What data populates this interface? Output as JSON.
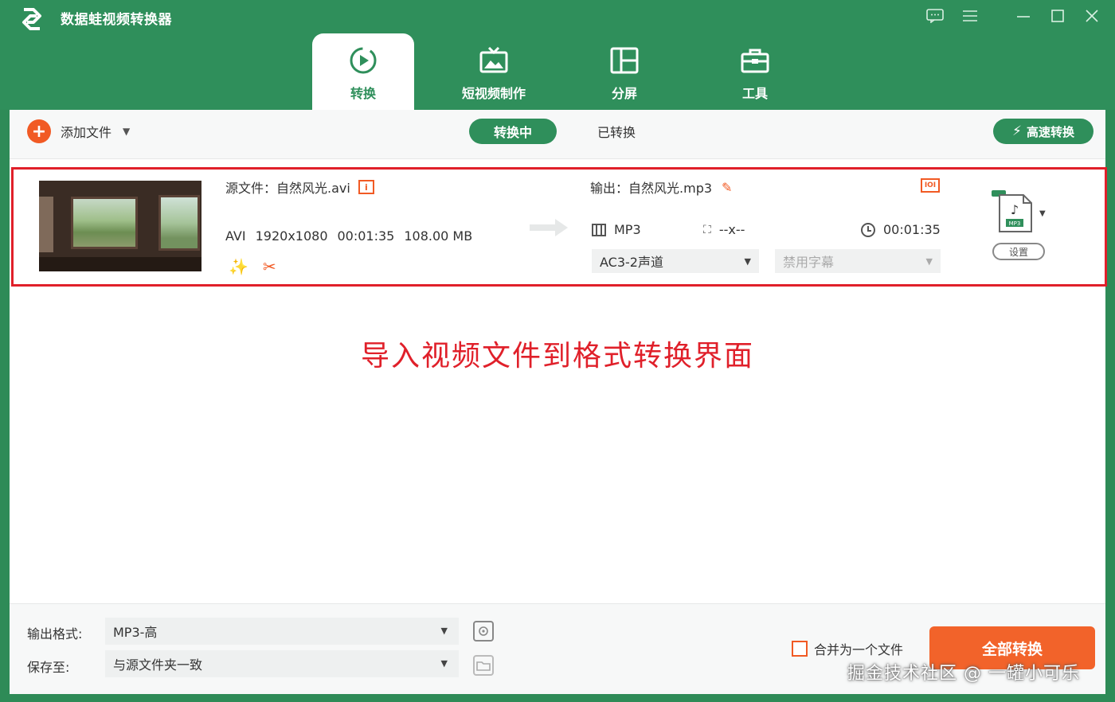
{
  "app": {
    "title": "数据蛙视频转换器"
  },
  "tabs": [
    {
      "label": "转换",
      "active": true
    },
    {
      "label": "短视频制作",
      "active": false
    },
    {
      "label": "分屏",
      "active": false
    },
    {
      "label": "工具",
      "active": false
    }
  ],
  "toolbar": {
    "add_file_label": "添加文件",
    "segment_active": "转换中",
    "segment_inactive": "已转换",
    "turbo_label": "高速转换"
  },
  "file_item": {
    "source_label": "源文件：",
    "source_name": "自然风光.avi",
    "source_format": "AVI",
    "resolution": "1920x1080",
    "duration": "00:01:35",
    "size": "108.00 MB",
    "output_label": "输出：",
    "output_name": "自然风光.mp3",
    "output_format": "MP3",
    "output_resolution": "--x--",
    "output_duration": "00:01:35",
    "audio_track": "AC3-2声道",
    "subtitle": "禁用字幕",
    "format_badge": "IOI",
    "file_icon_text": "MP3",
    "settings_label": "设置"
  },
  "annotation": "导入视频文件到格式转换界面",
  "bottom": {
    "output_format_label": "输出格式:",
    "output_format_value": "MP3-高",
    "save_to_label": "保存至:",
    "save_to_value": "与源文件夹一致",
    "merge_label": "合并为一个文件",
    "convert_all_label": "全部转换"
  },
  "watermark": "掘金技术社区 @ 一罐小可乐",
  "colors": {
    "brand_green": "#2f8f5b",
    "accent_orange": "#f15a24",
    "highlight_red": "#e0202a"
  }
}
